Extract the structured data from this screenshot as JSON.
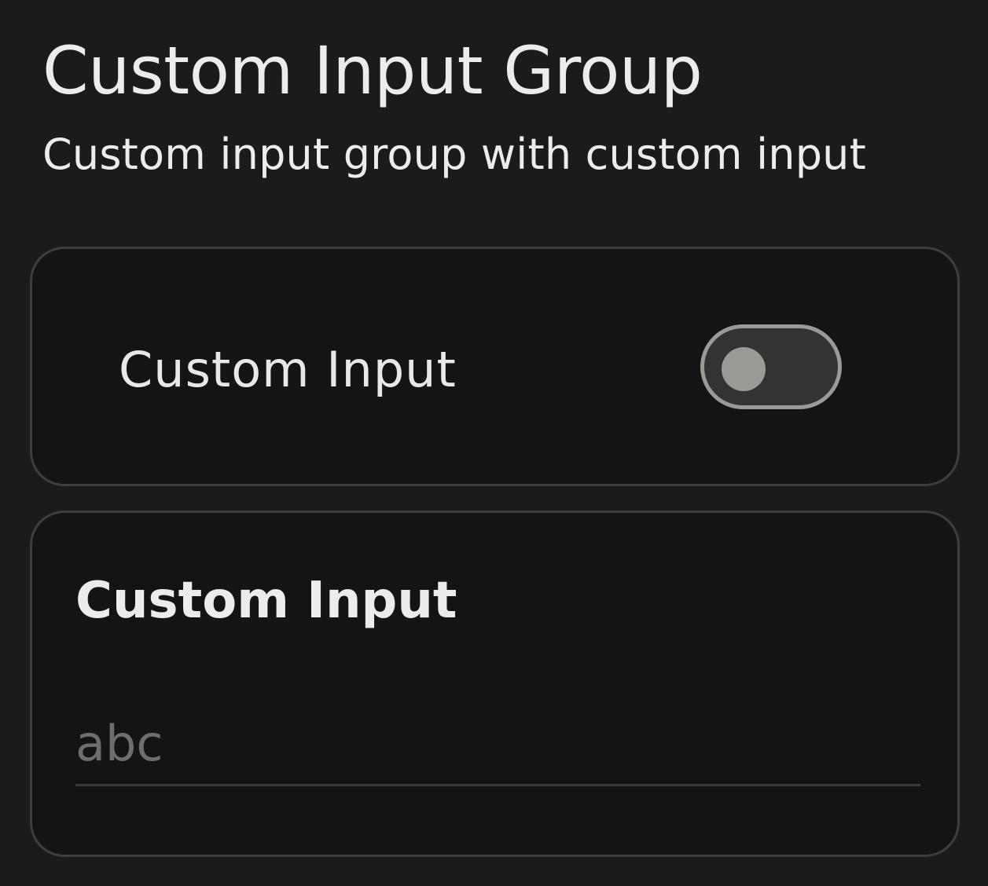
{
  "header": {
    "title": "Custom Input Group",
    "subtitle": "Custom input group with custom input"
  },
  "toggle_card": {
    "label": "Custom Input",
    "switch_on": false,
    "colors": {
      "track": "#343331",
      "thumb": "#9c9a97",
      "border": "#9c9a97"
    }
  },
  "text_card": {
    "label": "Custom Input",
    "value": "",
    "placeholder": "abc"
  },
  "colors": {
    "background": "#1b1b1b",
    "card_background": "#141414",
    "card_border": "#3e3e3e",
    "text": "#ececec"
  }
}
